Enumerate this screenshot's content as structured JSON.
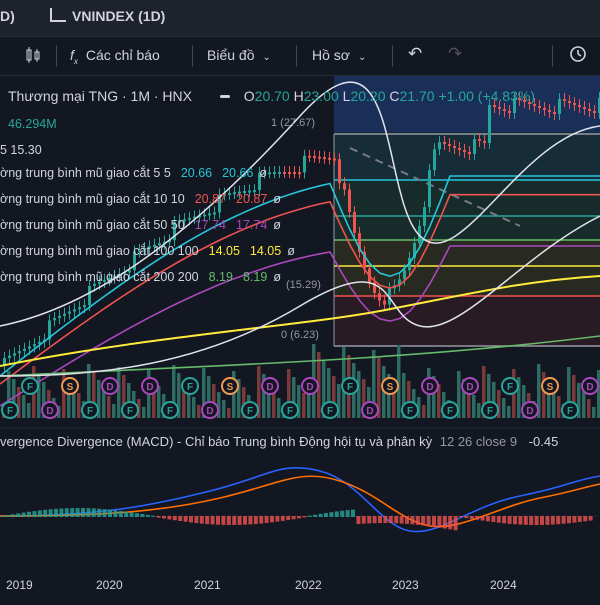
{
  "tabs": {
    "left_fragment": "D)",
    "index_tab": "VNINDEX (1D)"
  },
  "toolbar": {
    "indicators_label": "Các chỉ báo",
    "chart_label": "Biểu đồ",
    "profile_label": "Hồ sơ"
  },
  "symbol": {
    "name": "Thương mại TNG · 1M · HNX",
    "open_label": "O",
    "open": "20.70",
    "high_label": "H",
    "high": "23.00",
    "low_label": "L",
    "low": "20.20",
    "close_label": "C",
    "close": "21.70",
    "change": "+1.00 (+4.83%)",
    "volume": "46.294M",
    "bb_values": "5  15.30"
  },
  "ema_rows": [
    {
      "label": "ờng trung bình mũ giao cắt 5 5",
      "v1": "20.66",
      "v2": "20.66",
      "color": "#26c6da"
    },
    {
      "label": "ờng trung bình mũ giao cắt 10 10",
      "v1": "20.87",
      "v2": "20.87",
      "color": "#ef5350"
    },
    {
      "label": "ờng trung bình mũ giao cắt 50 50",
      "v1": "17.74",
      "v2": "17.74",
      "color": "#ab47bc"
    },
    {
      "label": "ờng trung bình mũ giao cắt 100 100",
      "v1": "14.05",
      "v2": "14.05",
      "color": "#ffeb3b"
    },
    {
      "label": "ờng trung bình mũ giao cắt 200 200",
      "v1": "8.19",
      "v2": "8.19",
      "color": "#66bb6a"
    }
  ],
  "fib": {
    "top_label": "1 (27.67)",
    "bottom_label": "0 (6.23)",
    "mid_label": "(15.29)"
  },
  "macd": {
    "label": "vergence Divergence (MACD) - Chỉ báo Trung bình Động hội tụ và phân kỳ",
    "params": "12 26 close 9",
    "value": "-0.45"
  },
  "x_axis": [
    "2019",
    "2020",
    "2021",
    "2022",
    "2023",
    "2024"
  ],
  "colors": {
    "up": "#26a69a",
    "down": "#ef5350",
    "bg": "#131722"
  }
}
